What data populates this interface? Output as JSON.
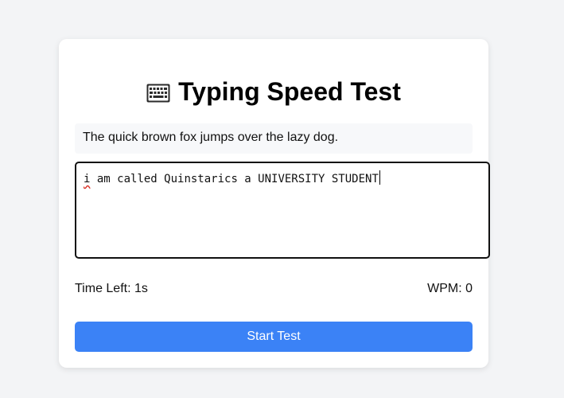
{
  "app": {
    "title": "Typing Speed Test",
    "title_icon": "keyboard-icon"
  },
  "prompt": {
    "text": "The quick brown fox jumps over the lazy dog."
  },
  "typing_area": {
    "value_first_word": "i",
    "value_rest": " am called Quinstarics a UNIVERSITY STUDENT"
  },
  "stats": {
    "time_left": "Time Left: 1s",
    "wpm": "WPM: 0"
  },
  "controls": {
    "start_label": "Start Test"
  },
  "colors": {
    "accent": "#3b82f6",
    "page_background": "#f3f4f6",
    "spellcheck_underline": "#d93025"
  }
}
